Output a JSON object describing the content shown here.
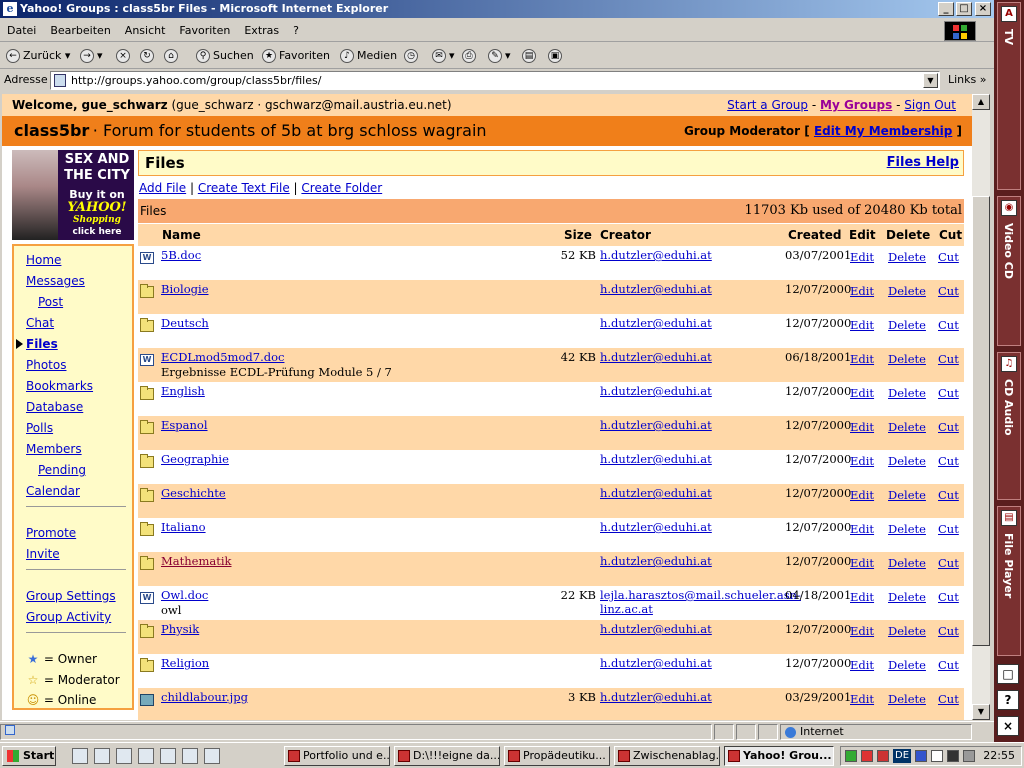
{
  "window": {
    "title": "Yahoo! Groups : class5br Files - Microsoft Internet Explorer",
    "min": "_",
    "max": "□",
    "close": "×"
  },
  "menu": [
    "Datei",
    "Bearbeiten",
    "Ansicht",
    "Favoriten",
    "Extras",
    "?"
  ],
  "toolbar": {
    "back": "Zurück",
    "search": "Suchen",
    "favorites": "Favoriten",
    "media": "Medien"
  },
  "address": {
    "label": "Adresse",
    "url": "http://groups.yahoo.com/group/class5br/files/",
    "links": "Links »"
  },
  "page": {
    "welcome": {
      "prefix": "Welcome,",
      "user": "gue_schwarz",
      "detail": "(gue_schwarz · gschwarz@mail.austria.eu.net)",
      "start_group": "Start a Group",
      "my_groups": "My Groups",
      "sign_out": "Sign Out",
      "sep": "-"
    },
    "group": {
      "name": "class5br",
      "tagline": "· Forum for students of 5b at brg schloss wagrain",
      "role": "Group Moderator",
      "edit_membership": "Edit My Membership",
      "lb": "[",
      "rb": "]"
    },
    "ad": {
      "line1": "SEX AND THE CITY",
      "line2": "Buy it on",
      "line3": "YAHOO!",
      "line4": "Shopping",
      "line5": "click here"
    },
    "nav": {
      "items": [
        "Home",
        "Messages",
        "Post",
        "Chat",
        "Files",
        "Photos",
        "Bookmarks",
        "Database",
        "Polls",
        "Members",
        "Pending",
        "Calendar"
      ],
      "promote": [
        "Promote",
        "Invite"
      ],
      "settings": [
        "Group Settings",
        "Group Activity"
      ],
      "legend": [
        {
          "sym": "★",
          "label": "= Owner",
          "color": "#3a6fd8"
        },
        {
          "sym": "☆",
          "label": "= Moderator",
          "color": "#e0b000"
        },
        {
          "sym": "☺",
          "label": "= Online",
          "color": "#c89000"
        }
      ]
    },
    "files": {
      "title": "Files",
      "help": "Files Help",
      "actions": [
        "Add File",
        "Create Text File",
        "Create Folder"
      ],
      "action_sep": "|",
      "summary_label": "Files",
      "usage": "11703 Kb used of 20480 Kb total",
      "columns": [
        "Name",
        "Size",
        "Creator",
        "Created",
        "Edit",
        "Delete",
        "Cut"
      ],
      "rows": [
        {
          "icon": "doc-icon",
          "name": "5B.doc",
          "desc": "",
          "size": "52 KB",
          "creator": "h.dutzler@eduhi.at",
          "created": "03/07/2001",
          "edit": "Edit",
          "delete": "Delete",
          "cut": "Cut"
        },
        {
          "icon": "folder-icon",
          "name": "Biologie",
          "desc": "",
          "size": "",
          "creator": "h.dutzler@eduhi.at",
          "created": "12/07/2000",
          "edit": "Edit",
          "delete": "Delete",
          "cut": "Cut"
        },
        {
          "icon": "folder-icon",
          "name": "Deutsch",
          "desc": "",
          "size": "",
          "creator": "h.dutzler@eduhi.at",
          "created": "12/07/2000",
          "edit": "Edit",
          "delete": "Delete",
          "cut": "Cut"
        },
        {
          "icon": "doc-icon",
          "name": "ECDLmod5mod7.doc",
          "desc": "Ergebnisse ECDL-Prüfung Module 5 / 7",
          "size": "42 KB",
          "creator": "h.dutzler@eduhi.at",
          "created": "06/18/2001",
          "edit": "Edit",
          "delete": "Delete",
          "cut": "Cut"
        },
        {
          "icon": "folder-icon",
          "name": "English",
          "desc": "",
          "size": "",
          "creator": "h.dutzler@eduhi.at",
          "created": "12/07/2000",
          "edit": "Edit",
          "delete": "Delete",
          "cut": "Cut"
        },
        {
          "icon": "folder-icon",
          "name": "Espanol",
          "desc": "",
          "size": "",
          "creator": "h.dutzler@eduhi.at",
          "created": "12/07/2000",
          "edit": "Edit",
          "delete": "Delete",
          "cut": "Cut"
        },
        {
          "icon": "folder-icon",
          "name": "Geographie",
          "desc": "",
          "size": "",
          "creator": "h.dutzler@eduhi.at",
          "created": "12/07/2000",
          "edit": "Edit",
          "delete": "Delete",
          "cut": "Cut"
        },
        {
          "icon": "folder-icon",
          "name": "Geschichte",
          "desc": "",
          "size": "",
          "creator": "h.dutzler@eduhi.at",
          "created": "12/07/2000",
          "edit": "Edit",
          "delete": "Delete",
          "cut": "Cut"
        },
        {
          "icon": "folder-icon",
          "name": "Italiano",
          "desc": "",
          "size": "",
          "creator": "h.dutzler@eduhi.at",
          "created": "12/07/2000",
          "edit": "Edit",
          "delete": "Delete",
          "cut": "Cut"
        },
        {
          "icon": "folder-icon",
          "name": "Mathematik",
          "desc": "",
          "size": "",
          "creator": "h.dutzler@eduhi.at",
          "created": "12/07/2000",
          "edit": "Edit",
          "delete": "Delete",
          "cut": "Cut"
        },
        {
          "icon": "doc-icon",
          "name": "Owl.doc",
          "desc": "owl",
          "size": "22 KB",
          "creator": "lejla.harasztos@mail.schueler.asn-linz.ac.at",
          "created": "04/18/2001",
          "edit": "Edit",
          "delete": "Delete",
          "cut": "Cut"
        },
        {
          "icon": "folder-icon",
          "name": "Physik",
          "desc": "",
          "size": "",
          "creator": "h.dutzler@eduhi.at",
          "created": "12/07/2000",
          "edit": "Edit",
          "delete": "Delete",
          "cut": "Cut"
        },
        {
          "icon": "folder-icon",
          "name": "Religion",
          "desc": "",
          "size": "",
          "creator": "h.dutzler@eduhi.at",
          "created": "12/07/2000",
          "edit": "Edit",
          "delete": "Delete",
          "cut": "Cut"
        },
        {
          "icon": "image-icon",
          "name": "childlabour.jpg",
          "desc": "",
          "size": "3 KB",
          "creator": "h.dutzler@eduhi.at",
          "created": "03/29/2001",
          "edit": "Edit",
          "delete": "Delete",
          "cut": "Cut"
        }
      ]
    }
  },
  "status": {
    "zone": "Internet"
  },
  "sidebar": {
    "tabs": [
      "TV",
      "Video CD",
      "CD Audio",
      "File Player"
    ],
    "buttons": [
      "□",
      "?",
      "×"
    ]
  },
  "taskbar": {
    "start": "Start",
    "tasks": [
      "Portfolio und e...",
      "D:\\!!!eigne da...",
      "Propädeutiku...",
      "Zwischenablag...",
      "Yahoo! Grou..."
    ],
    "active_index": 4,
    "tray_lang": "DE",
    "clock": "22:55"
  }
}
